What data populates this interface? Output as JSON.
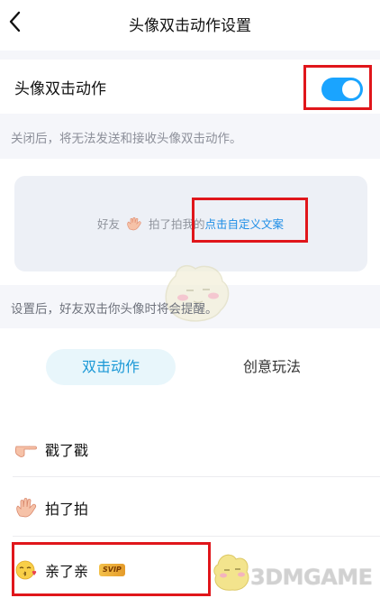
{
  "nav": {
    "title": "头像双击动作设置",
    "back_icon": "chevron-left-icon"
  },
  "setting": {
    "label": "头像双击动作",
    "toggle_on": true,
    "toggle_color": "#1aa4ff"
  },
  "hints": {
    "off_hint": "关闭后，将无法发送和接收头像双击动作。",
    "after_hint": "设置后，好友双击你头像时将会提醒。"
  },
  "preview": {
    "prefix": "好友",
    "action": "拍了拍我的",
    "custom_link": "点击自定义文案",
    "icon": "waving-hand-icon"
  },
  "tabs": [
    {
      "label": "双击动作",
      "active": true
    },
    {
      "label": "创意玩法",
      "active": false
    }
  ],
  "actions": [
    {
      "label": "戳了戳",
      "icon": "pointing-hand-icon"
    },
    {
      "label": "拍了拍",
      "icon": "waving-hand-icon"
    },
    {
      "label": "亲了亲",
      "icon": "kissing-face-icon",
      "badge": "SVIP"
    }
  ],
  "watermark": {
    "text": "3DMGAME"
  },
  "colors": {
    "accent": "#1a98d6",
    "highlight_box": "#e0161b",
    "link": "#1c8de6"
  }
}
